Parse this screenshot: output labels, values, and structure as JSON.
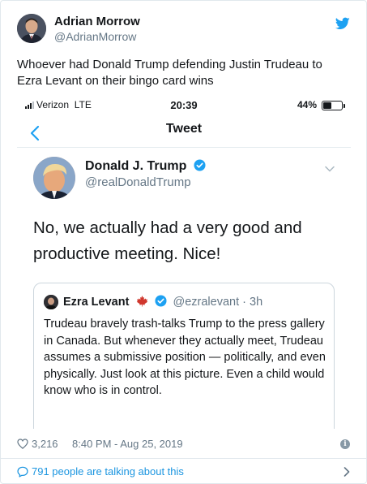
{
  "embed": {
    "author_name": "Adrian Morrow",
    "author_handle": "@AdrianMorrow",
    "tweet_text": "Whoever had Donald Trump defending Justin Trudeau to Ezra Levant on their bingo card wins",
    "likes": "3,216",
    "timestamp": "8:40 PM - Aug 25, 2019",
    "talking_text": "791 people are talking about this",
    "icons": {
      "brand": "twitter-bird-icon",
      "like": "heart-icon",
      "info": "info-icon",
      "conversation": "speech-bubble-icon",
      "more": "chevron-right-icon"
    },
    "colors": {
      "brand_blue": "#1da1f2",
      "link_blue": "#1b95e0",
      "muted": "#657786"
    }
  },
  "screenshot": {
    "status_bar": {
      "carrier": "Verizon",
      "network": "LTE",
      "time": "20:39",
      "battery": "44%",
      "battery_level": 0.44
    },
    "nav": {
      "back_icon": "chevron-left-icon",
      "title": "Tweet"
    },
    "tweet": {
      "name": "Donald J. Trump",
      "handle": "@realDonaldTrump",
      "text": "No, we actually had a very good and productive meeting. Nice!"
    },
    "quote": {
      "name": "Ezra Levant",
      "handle": "@ezralevant",
      "time": "3h",
      "text": "Trudeau bravely trash-talks Trump to the press gallery in Canada. But whenever they actually meet, Trudeau assumes a submissive position — politically, and even physically. Just look at this picture. Even a child would know who is in control."
    }
  }
}
